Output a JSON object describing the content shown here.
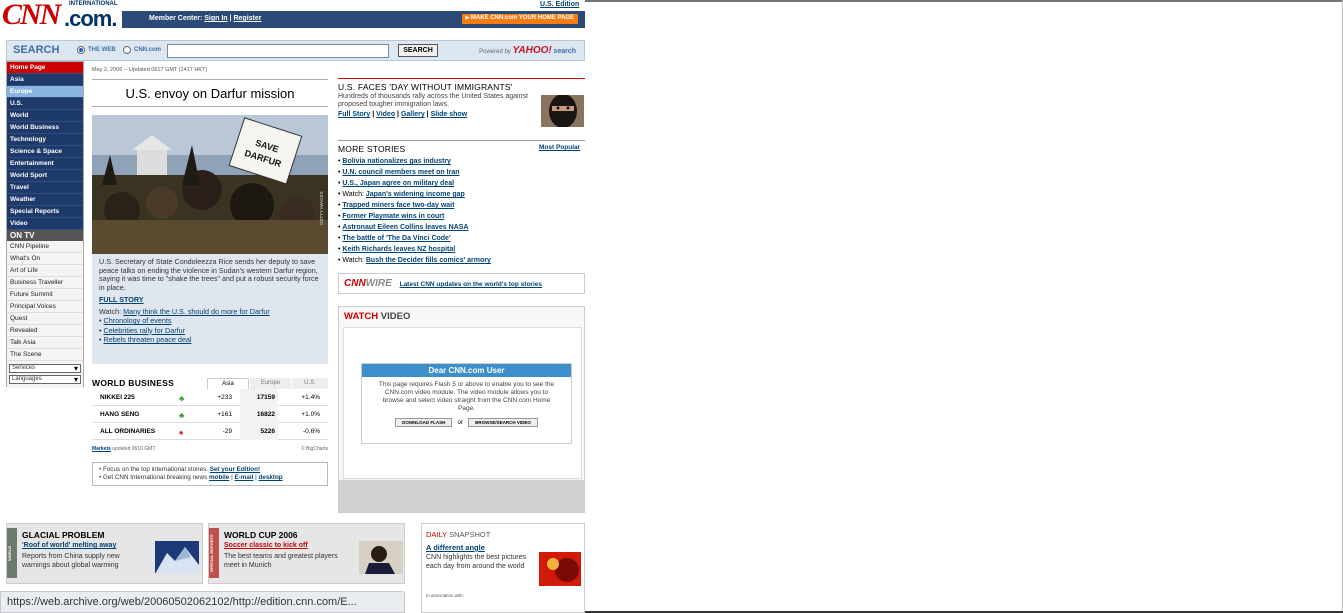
{
  "header": {
    "logo_intl": "INTERNATIONAL",
    "logo_cnn": "CNN",
    "logo_com": ".com.",
    "edition": "U.S. Edition",
    "member_center": "Member Center:",
    "sign_in": "Sign In",
    "separator": "|",
    "register": "Register",
    "make_home": "MAKE CNN.com YOUR HOME PAGE"
  },
  "search": {
    "label": "SEARCH",
    "opt_web": "THE WEB",
    "opt_cnn": "CNN.com",
    "button": "SEARCH",
    "powered": "Powered by",
    "yahoo": "YAHOO!",
    "yahoo_search": "search"
  },
  "nav": {
    "items": [
      "Home Page",
      "Asia",
      "Europe",
      "U.S.",
      "World",
      "World Business",
      "Technology",
      "Science & Space",
      "Entertainment",
      "World Sport",
      "Travel",
      "Weather",
      "Special Reports",
      "Video"
    ],
    "ontv_label": "ON TV",
    "tv_items": [
      "CNN Pipeline",
      "What's On",
      "Art of Life",
      "Business Traveller",
      "Future Summit",
      "Principal Voices",
      "Quest",
      "Revealed",
      "Talk Asia",
      "The Scene"
    ],
    "services": "Services",
    "languages": "Languages"
  },
  "main": {
    "date": "May 2, 2006 -- Updated 0617 GMT (1417 HKT)",
    "headline": "U.S. envoy on Darfur mission",
    "sign_text": "SAVE DARFUR",
    "photo_credit": "GETTY IMAGES",
    "summary": "U.S. Secretary of State Condoleezza Rice sends her deputy to save peace talks on ending the violence in Sudan's western Darfur region, saying it was time to \"shake the trees\" and put a robust security force in place.",
    "full_story": "FULL STORY",
    "watch_prefix": "Watch:",
    "watch_link": "Many think the U.S. should do more for Darfur",
    "bullets": [
      "Chronology of events",
      "Celebrities rally for Darfur",
      "Rebels threaten peace deal"
    ]
  },
  "world_business": {
    "title": "WORLD BUSINESS",
    "tabs": [
      "Asia",
      "Europe",
      "U.S."
    ],
    "rows": [
      {
        "name": "NIKKEI 225",
        "dir": "up",
        "change": "+233",
        "value": "17159",
        "pct": "+1.4%"
      },
      {
        "name": "HANG SENG",
        "dir": "up",
        "change": "+161",
        "value": "16822",
        "pct": "+1.0%"
      },
      {
        "name": "ALL ORDINARIES",
        "dir": "down",
        "change": "-29",
        "value": "5226",
        "pct": "-0.6%"
      }
    ],
    "markets": "Markets",
    "updated": "updated 0610 GMT",
    "source": "© BigCharts"
  },
  "info": {
    "line1": "• Focus on the top international stories.",
    "set_edition": "Set your Edition!",
    "line2": "• Get CNN International breaking news",
    "mobile": "mobile",
    "sep": "|",
    "email": "E-mail",
    "desktop": "desktop"
  },
  "immigrants": {
    "title": "U.S. FACES 'DAY WITHOUT IMMIGRANTS'",
    "text": "Hundreds of thousands rally across the United States against proposed tougher immigration laws.",
    "links": [
      "Full Story",
      "Video",
      "Gallery",
      "Slide show"
    ],
    "sep": "|"
  },
  "more": {
    "title": "MORE STORIES",
    "most_popular": "Most Popular",
    "stories": [
      {
        "prefix": "• ",
        "link": "Bolivia nationalizes gas industry"
      },
      {
        "prefix": "• ",
        "link": "U.N. council members meet on Iran"
      },
      {
        "prefix": "• ",
        "link": "U.S., Japan agree on military deal"
      },
      {
        "prefix": "• Watch: ",
        "link": "Japan's widening income gap"
      },
      {
        "prefix": "• ",
        "link": "Trapped miners face two-day wait"
      },
      {
        "prefix": "• ",
        "link": "Former Playmate wins in court"
      },
      {
        "prefix": "• ",
        "link": "Astronaut Eileen Collins leaves NASA"
      },
      {
        "prefix": "• ",
        "link": "The battle of 'The Da Vinci Code'"
      },
      {
        "prefix": "• ",
        "link": "Keith Richards leaves NZ hospital"
      },
      {
        "prefix": "• Watch: ",
        "link": "Bush the Decider fills comics' armory"
      }
    ]
  },
  "wire": {
    "logo_cnn": "CNN",
    "logo_wire": "WIRE",
    "text": "Latest CNN updates on the world's top stories"
  },
  "video": {
    "watch": "WATCH",
    "video": "VIDEO",
    "dialog_title": "Dear CNN.com User",
    "dialog_text": "This page requires Flash 5 or above to enable you to see the CNN.com video module. The video module allows you to browse and select video straight from the CNN.com Home Page.",
    "download_btn": "DOWNLOAD FLASH",
    "or": "or",
    "browse_btn": "BROWSE/SEARCH VIDEO"
  },
  "promos": [
    {
      "tag": "WORLD",
      "title": "GLACIAL PROBLEM",
      "link": "'Roof of world' melting away",
      "desc": "Reports from China supply new warnings about global warming"
    },
    {
      "tag": "SPECIAL REPORTS",
      "title": "WORLD CUP 2006",
      "link": "Soccer classic to kick off",
      "desc": "The best teams and greatest players meet in Munich"
    }
  ],
  "snapshot": {
    "title_a": "DAILY ",
    "title_b": "SNAPSHOT",
    "link": "A different angle",
    "desc": "CNN highlights the best pictures each day from around the world",
    "assoc": "In association with:"
  },
  "status_url": "https://web.archive.org/web/20060502062102/http://edition.cnn.com/E...",
  "colors": {
    "cnn_red": "#cc0000",
    "nav_blue": "#1d3a6b",
    "link_blue": "#004276",
    "up_green": "#2a9a2a",
    "down_red": "#cc2222"
  }
}
